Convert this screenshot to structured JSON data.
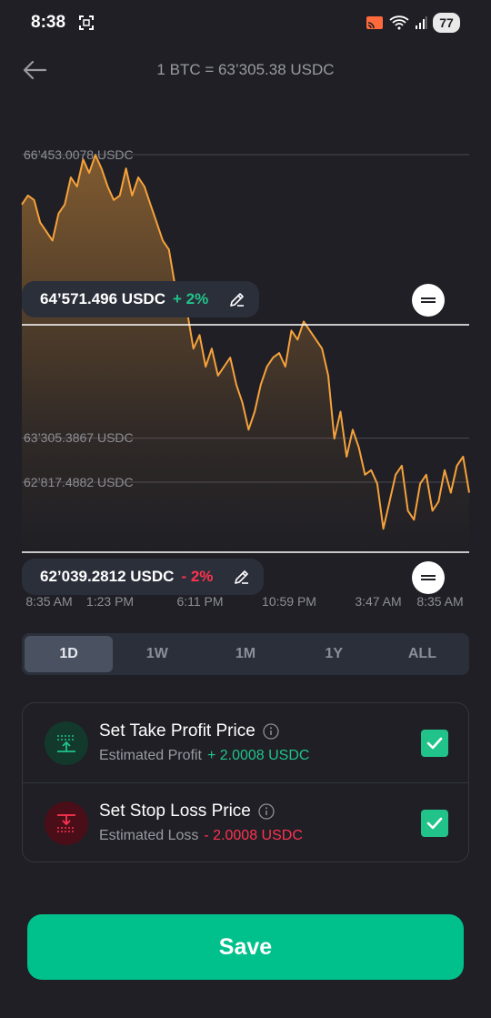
{
  "status_bar": {
    "time": "8:38",
    "battery": "77"
  },
  "header": {
    "title": "1 BTC = 63’305.38 USDC"
  },
  "price_chart": {
    "y_labels": [
      "66’453.0078 USDC",
      "63’305.3867 USDC",
      "62’817.4882 USDC"
    ],
    "x_labels": [
      "8:35 AM",
      "1:23 PM",
      "6:11 PM",
      "10:59 PM",
      "3:47 AM",
      "8:35 AM"
    ],
    "line_color": "#f5a23c",
    "take_profit": {
      "price": "64’571.496 USDC",
      "percent": "+ 2%"
    },
    "stop_loss": {
      "price": "62’039.2812 USDC",
      "percent": "- 2%"
    }
  },
  "chart_data": {
    "type": "area",
    "series": [
      {
        "values": [
          65.9,
          66.0,
          65.95,
          65.7,
          65.6,
          65.5,
          65.8,
          65.9,
          66.2,
          66.1,
          66.4,
          66.25,
          66.45,
          66.3,
          66.1,
          65.95,
          66.0,
          66.3,
          66.0,
          66.2,
          66.1,
          65.9,
          65.7,
          65.5,
          65.4,
          65.0,
          64.9,
          64.7,
          64.3,
          64.45,
          64.1,
          64.3,
          64.0,
          64.1,
          64.2,
          63.9,
          63.7,
          63.4,
          63.6,
          63.9,
          64.1,
          64.2,
          64.25,
          64.1,
          64.5,
          64.4,
          64.6,
          64.5,
          64.4,
          64.3,
          64.0,
          63.3,
          63.6,
          63.1,
          63.4,
          63.2,
          62.9,
          62.95,
          62.8,
          62.3,
          62.6,
          62.9,
          63.0,
          62.5,
          62.4,
          62.8,
          62.9,
          62.5,
          62.6,
          62.95,
          62.7,
          63.0,
          63.1,
          62.7
        ]
      }
    ],
    "x_ticks": [
      "8:35 AM",
      "1:23 PM",
      "6:11 PM",
      "10:59 PM",
      "3:47 AM",
      "8:35 AM"
    ],
    "y_ticks": [
      66453.0078,
      63305.3867,
      62817.4882
    ],
    "y_unit": "USDC"
  },
  "range_tabs": [
    {
      "label": "1D",
      "active": true
    },
    {
      "label": "1W",
      "active": false
    },
    {
      "label": "1M",
      "active": false
    },
    {
      "label": "1Y",
      "active": false
    },
    {
      "label": "ALL",
      "active": false
    }
  ],
  "options": {
    "take_profit": {
      "title": "Set Take Profit Price",
      "subtitle": "Estimated Profit",
      "value": "+ 2.0008 USDC",
      "checked": true
    },
    "stop_loss": {
      "title": "Set Stop Loss Price",
      "subtitle": "Estimated Loss",
      "value": "- 2.0008 USDC",
      "checked": true
    }
  },
  "save_label": "Save",
  "colors": {
    "background": "#1f1f25",
    "accent_green": "#00c08b",
    "profit_green": "#21c38a",
    "loss_red": "#ff3350",
    "chart_orange": "#f5a23c"
  }
}
